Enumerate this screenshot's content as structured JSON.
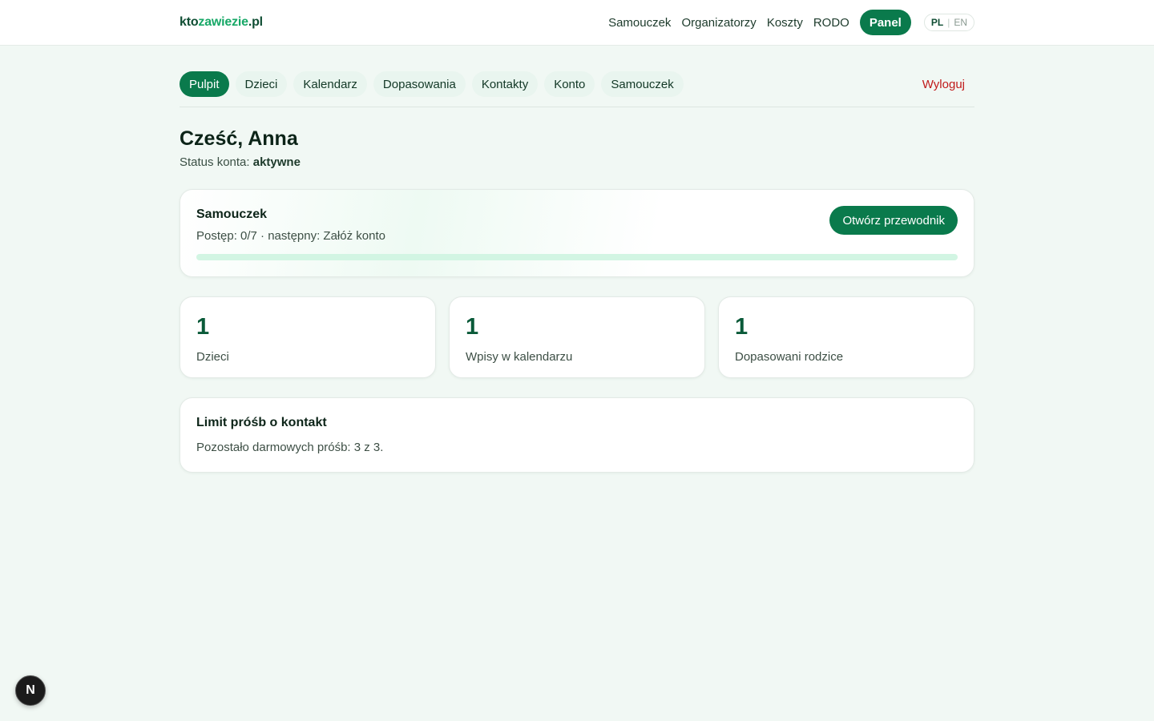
{
  "header": {
    "logo": {
      "part1": "kto",
      "part2": "zawiezie",
      "part3": ".pl"
    },
    "nav": [
      "Samouczek",
      "Organizatorzy",
      "Koszty",
      "RODO"
    ],
    "panel_label": "Panel",
    "lang": {
      "active": "PL",
      "separator": "|",
      "other": "EN"
    }
  },
  "subnav": {
    "tabs": [
      "Pulpit",
      "Dzieci",
      "Kalendarz",
      "Dopasowania",
      "Kontakty",
      "Konto",
      "Samouczek"
    ],
    "active_index": 0,
    "logout_label": "Wyloguj"
  },
  "greeting": "Cześć, Anna",
  "status": {
    "label": "Status konta:",
    "value": "aktywne"
  },
  "tutorial": {
    "title": "Samouczek",
    "progress_text": "Postęp: 0/7 · następny: Załóż konto",
    "progress_fraction": 0,
    "button_label": "Otwórz przewodnik"
  },
  "stats": [
    {
      "value": "1",
      "label": "Dzieci"
    },
    {
      "value": "1",
      "label": "Wpisy w kalendarzu"
    },
    {
      "value": "1",
      "label": "Dopasowani rodzice"
    }
  ],
  "limit": {
    "title": "Limit próśb o kontakt",
    "text": "Pozostało darmowych próśb: 3 z 3."
  },
  "dev_badge": "N",
  "colors": {
    "accent": "#0a7a4c",
    "logout": "#c01a1a",
    "background": "#f1f8f4"
  }
}
